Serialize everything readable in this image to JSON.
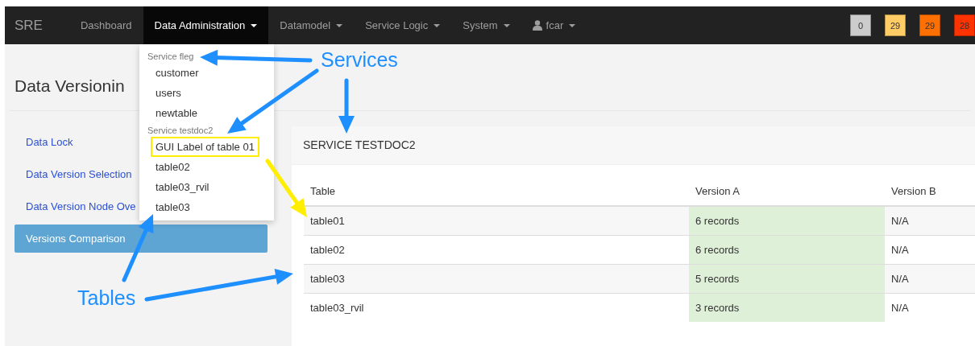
{
  "navbar": {
    "brand": "SRE",
    "items": [
      {
        "label": "Dashboard",
        "kind": "link",
        "selected": false,
        "dropdown": false
      },
      {
        "label": "Data Administration",
        "kind": "link",
        "selected": true,
        "dropdown": true
      },
      {
        "label": "Datamodel",
        "kind": "link",
        "selected": false,
        "dropdown": true
      },
      {
        "label": "Service Logic",
        "kind": "link",
        "selected": false,
        "dropdown": true
      },
      {
        "label": "System",
        "kind": "link",
        "selected": false,
        "dropdown": true
      },
      {
        "label": "fcar",
        "kind": "user",
        "selected": false,
        "dropdown": true
      }
    ],
    "badges": [
      {
        "label": "0",
        "color": "#cccccc"
      },
      {
        "label": "29",
        "color": "#ffcc66"
      },
      {
        "label": "29",
        "color": "#ff7000"
      },
      {
        "label": "28",
        "color": "#ff3300"
      }
    ]
  },
  "dropdown": {
    "groups": [
      {
        "header": "Service fleg",
        "items": [
          {
            "label": "customer",
            "highlighted": false
          },
          {
            "label": "users",
            "highlighted": false
          },
          {
            "label": "newtable",
            "highlighted": false
          }
        ]
      },
      {
        "header": "Service testdoc2",
        "items": [
          {
            "label": "GUI Label of table 01",
            "highlighted": true
          },
          {
            "label": "table02",
            "highlighted": false
          },
          {
            "label": "table03_rvil",
            "highlighted": false
          },
          {
            "label": "table03",
            "highlighted": false
          }
        ]
      }
    ]
  },
  "page_title": "Data Versionin",
  "sidebar": {
    "items": [
      {
        "label": "Data Lock",
        "selected": false
      },
      {
        "label": "Data Version Selection",
        "selected": false
      },
      {
        "label": "Data Version Node Ove",
        "selected": false
      },
      {
        "label": "Versions Comparison",
        "selected": true
      }
    ]
  },
  "panel": {
    "title": "SERVICE TESTDOC2",
    "table": {
      "columns": [
        {
          "label": "Table",
          "highlight": false
        },
        {
          "label": "Version A",
          "highlight": true
        },
        {
          "label": "Version B",
          "highlight": false
        }
      ],
      "rows": [
        {
          "cells": [
            "table01",
            "6 records",
            "N/A"
          ]
        },
        {
          "cells": [
            "table02",
            "6 records",
            "N/A"
          ]
        },
        {
          "cells": [
            "table03",
            "5 records",
            "N/A"
          ]
        },
        {
          "cells": [
            "table03_rvil",
            "3 records",
            "N/A"
          ]
        }
      ]
    }
  },
  "annotations": [
    {
      "text": "Services"
    },
    {
      "text": "Tables"
    }
  ]
}
